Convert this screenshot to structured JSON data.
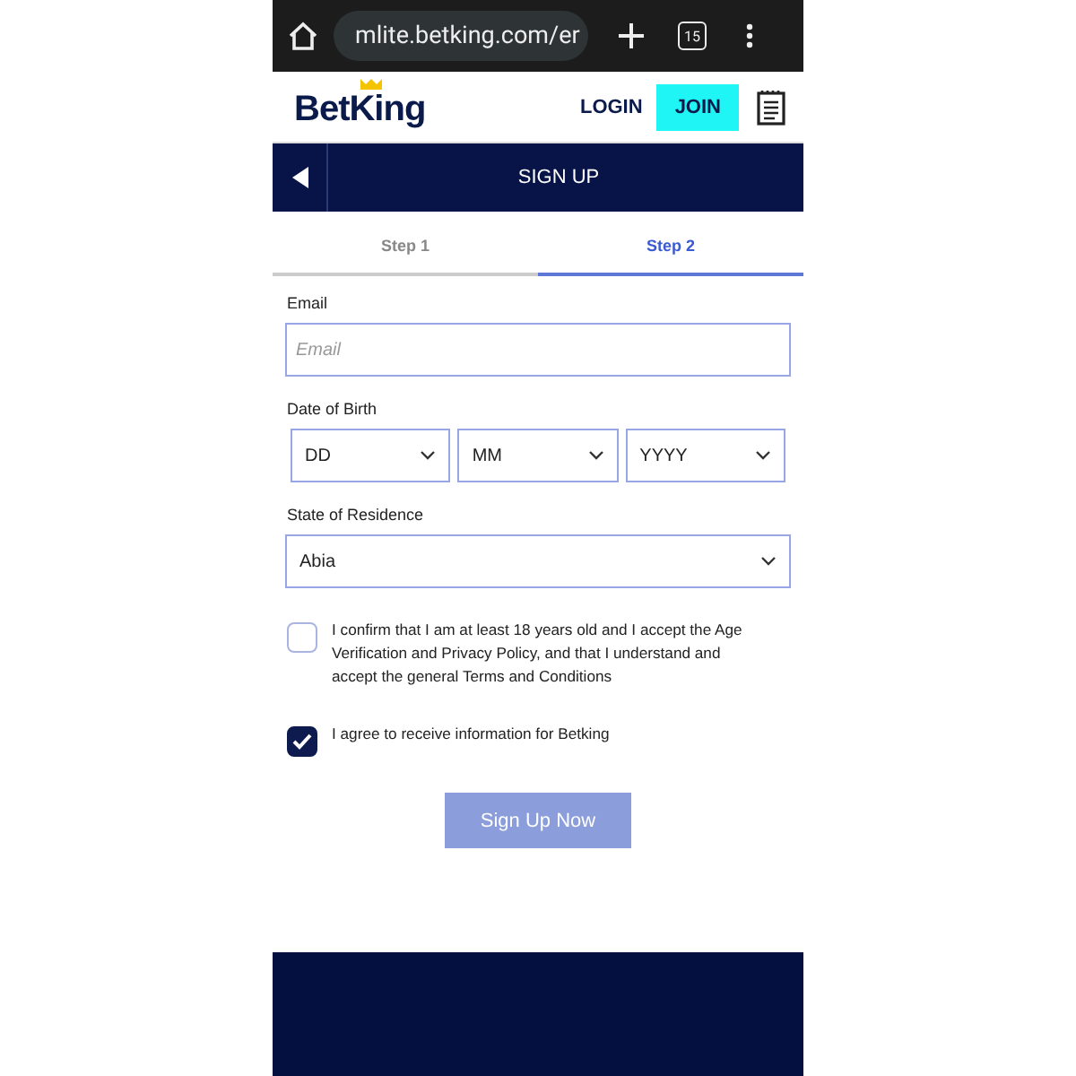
{
  "browser": {
    "url": "mlite.betking.com/er",
    "tab_count": "15"
  },
  "header": {
    "logo": "BetKing",
    "login": "LOGIN",
    "join": "JOIN"
  },
  "title_bar": {
    "title": "SIGN UP"
  },
  "steps": [
    {
      "label": "Step 1",
      "selected": false
    },
    {
      "label": "Step 2",
      "selected": true
    }
  ],
  "form": {
    "email": {
      "label": "Email",
      "placeholder": "Email"
    },
    "dob": {
      "label": "Date of Birth",
      "fields": [
        "DD",
        "MM",
        "YYYY"
      ]
    },
    "state": {
      "label": "State of Residence",
      "value": "Abia"
    },
    "checks": [
      {
        "text": "I confirm that I am at least 18 years old and I accept the Age Verification and Privacy Policy, and that I understand and accept the general Terms and Conditions",
        "checked": false
      },
      {
        "text": "I agree to receive information for Betking",
        "checked": true
      }
    ],
    "submit": {
      "label": "Sign Up Now",
      "disabled": true
    }
  }
}
